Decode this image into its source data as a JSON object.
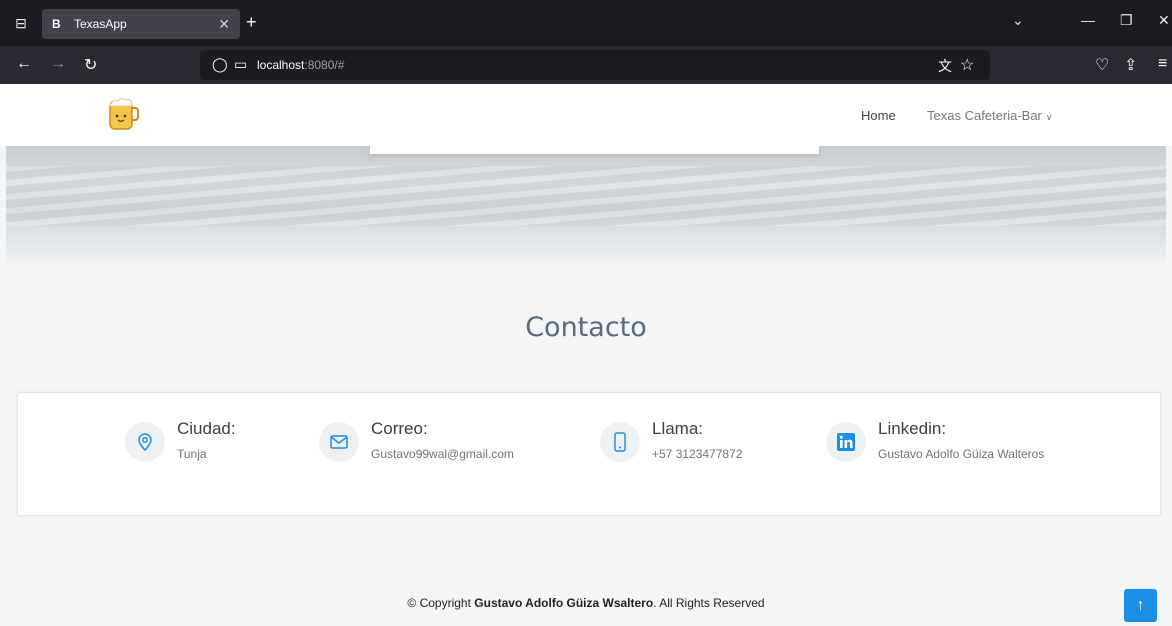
{
  "browser": {
    "tab_title": "TexasApp",
    "tab_favicon": "B",
    "url_host": "localhost",
    "url_rest": ":8080/#"
  },
  "header": {
    "nav_home": "Home",
    "nav_texas": "Texas Cafeteria-Bar"
  },
  "contact": {
    "title": "Contacto",
    "items": [
      {
        "icon": "location-pin-icon",
        "label": "Ciudad:",
        "value": "Tunja"
      },
      {
        "icon": "envelope-icon",
        "label": "Correo:",
        "value": "Gustavo99wal@gmail.com"
      },
      {
        "icon": "phone-icon",
        "label": "Llama:",
        "value": "+57 3123477872"
      },
      {
        "icon": "linkedin-icon",
        "label": "Linkedin:",
        "value": "Gustavo Adolfo Güiza Walteros"
      }
    ]
  },
  "footer": {
    "prefix": "© Copyright ",
    "owner": "Gustavo Adolfo Güiza Wsaltero",
    "suffix": ". All Rights Reserved"
  },
  "colors": {
    "accent": "#1a8fe3",
    "icon": "#1a8fe3"
  }
}
